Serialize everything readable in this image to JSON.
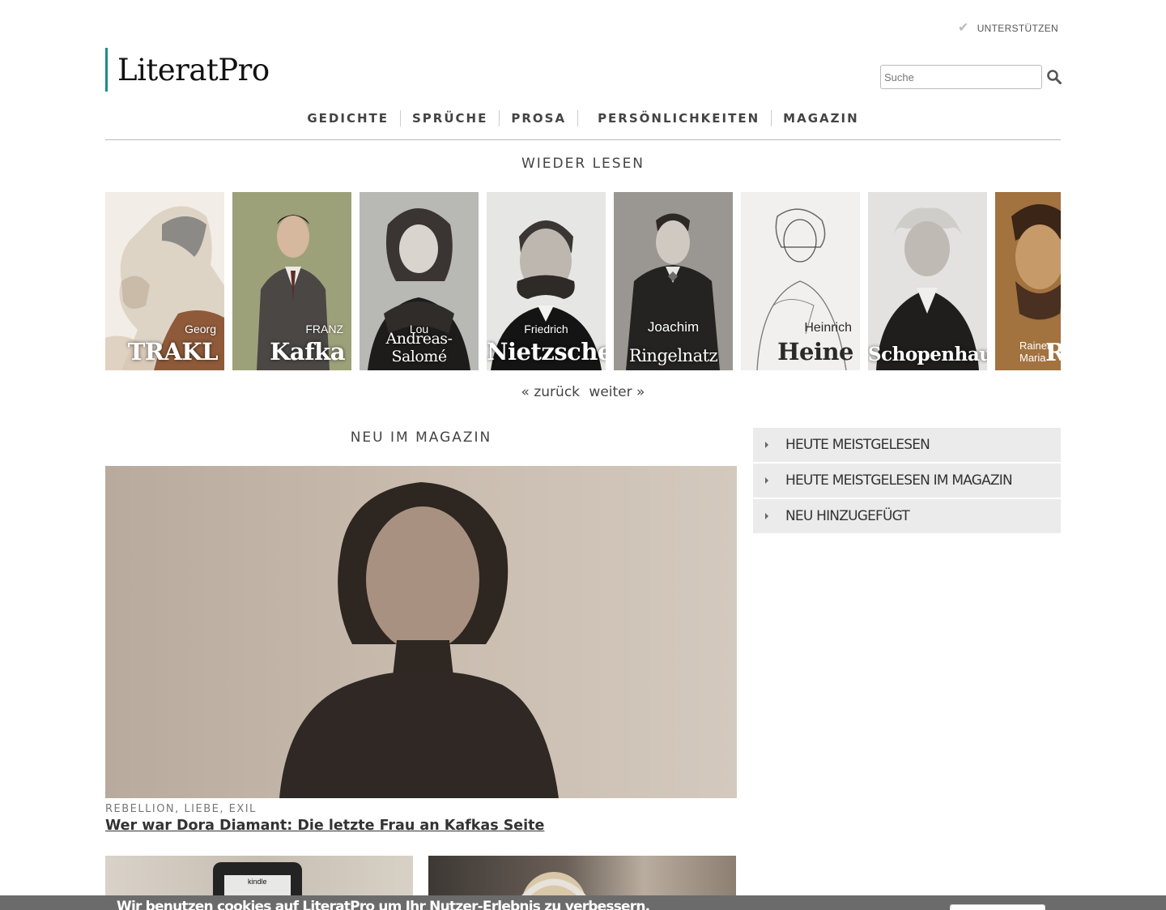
{
  "header": {
    "support_label": "UNTERSTÜTZEN",
    "logo_text": "LiteratPro",
    "search_placeholder": "Suche",
    "accent_color": "#1a8f8a"
  },
  "nav": {
    "items": [
      {
        "label": "GEDICHTE"
      },
      {
        "label": "SPRÜCHE"
      },
      {
        "label": "PROSA"
      },
      {
        "label": "PERSÖNLICHKEITEN"
      },
      {
        "label": "MAGAZIN"
      }
    ]
  },
  "reread": {
    "title": "WIEDER LESEN",
    "cards": [
      {
        "first": "Georg",
        "last": "TRAKL"
      },
      {
        "first": "FRANZ",
        "last": "Kafka"
      },
      {
        "first": "Lou",
        "last": "Andreas-Salomé"
      },
      {
        "first": "Friedrich",
        "last": "Nietzsche"
      },
      {
        "first": "Joachim",
        "last": "Ringelnatz"
      },
      {
        "first": "Heinrich",
        "last": "Heine"
      },
      {
        "first": "",
        "last": "Schopenhauer"
      },
      {
        "first": "Rainer Maria",
        "last": "R"
      }
    ],
    "prev_label": "« zurück",
    "next_label": "weiter »"
  },
  "magazine": {
    "title": "NEU IM MAGAZIN",
    "featured": {
      "tags": "REBELLION, LIEBE, EXIL",
      "headline": "Wer war Dora Diamant: Die letzte Frau an Kafkas Seite"
    },
    "kindle_label": "kindle"
  },
  "sidebar": {
    "items": [
      {
        "label": "HEUTE MEISTGELESEN"
      },
      {
        "label": "HEUTE MEISTGELESEN IM MAGAZIN"
      },
      {
        "label": "NEU HINZUGEFÜGT"
      }
    ]
  },
  "cookie": {
    "text": "Wir benutzen cookies auf LiteratPro um Ihr Nutzer-Erlebnis zu verbessern."
  }
}
